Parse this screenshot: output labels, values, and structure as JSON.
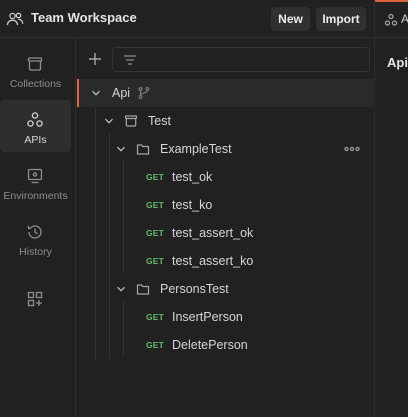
{
  "header": {
    "workspace_title": "Team Workspace",
    "new_label": "New",
    "import_label": "Import",
    "workspace_icon": "team-icon"
  },
  "nav": {
    "items": [
      {
        "label": "Collections",
        "icon": "collections-icon"
      },
      {
        "label": "APIs",
        "icon": "apis-icon",
        "active": true
      },
      {
        "label": "Environments",
        "icon": "environments-icon"
      },
      {
        "label": "History",
        "icon": "history-icon"
      }
    ],
    "extra_icon": "add-widgets-icon"
  },
  "tree": {
    "api": {
      "label": "Api",
      "icon": "branch-icon"
    },
    "collection": {
      "label": "Test"
    },
    "folders": [
      {
        "label": "ExampleTest",
        "requests": [
          {
            "method": "GET",
            "label": "test_ok"
          },
          {
            "method": "GET",
            "label": "test_ko"
          },
          {
            "method": "GET",
            "label": "test_assert_ok"
          },
          {
            "method": "GET",
            "label": "test_assert_ko"
          }
        ]
      },
      {
        "label": "PersonsTest",
        "requests": [
          {
            "method": "GET",
            "label": "InsertPerson"
          },
          {
            "method": "GET",
            "label": "DeletePerson"
          }
        ]
      }
    ]
  },
  "right_panel": {
    "tab_glyph": "A",
    "title": "Api"
  },
  "colors": {
    "accent": "#e0643a",
    "get_method": "#63b86c",
    "background": "#212121"
  }
}
